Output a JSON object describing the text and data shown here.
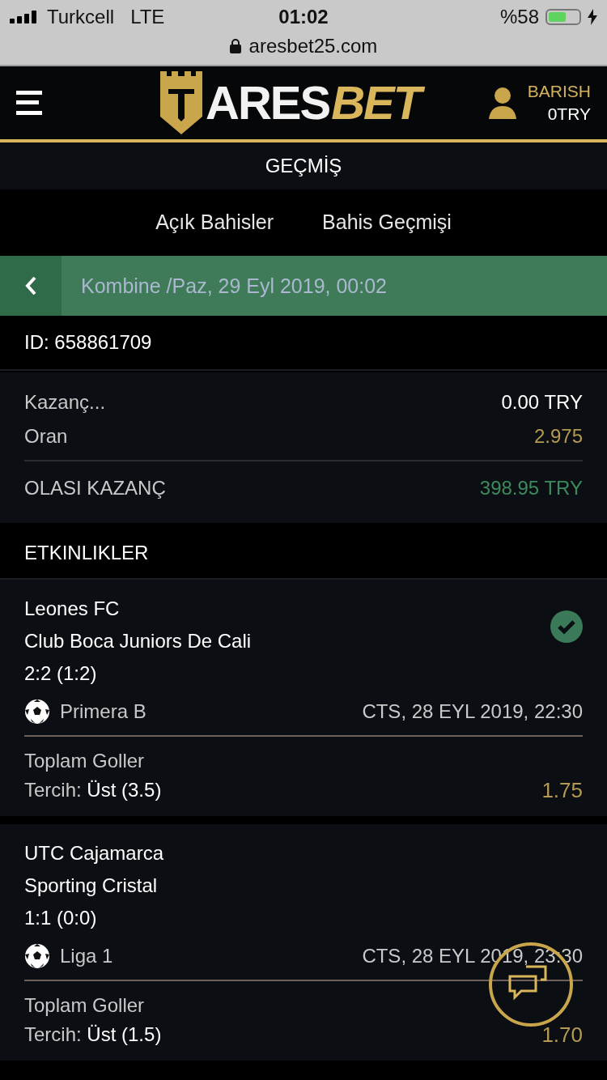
{
  "status_bar": {
    "carrier": "Turkcell",
    "network": "LTE",
    "time": "01:02",
    "battery_percent": "%58",
    "url": "aresbet25.com"
  },
  "header": {
    "logo_left": "ARES",
    "logo_right": "BET",
    "user_name": "BARISH",
    "balance": "0TRY"
  },
  "page_title": "GEÇMİŞ",
  "tabs": [
    {
      "label": "Açık Bahisler",
      "selected": false
    },
    {
      "label": "Bahis Geçmişi",
      "selected": false
    }
  ],
  "bet_header": {
    "title": "Kombine /Paz, 29 Eyl 2019, 00:02"
  },
  "bet_id": "ID: 658861709",
  "summary": [
    {
      "label": "Kazanç...",
      "value": "0.00 TRY",
      "kind": "plain"
    },
    {
      "label": "Oran",
      "value": "2.975",
      "kind": "odds"
    },
    {
      "label": "OLASI KAZANÇ",
      "value": "398.95 TRY",
      "kind": "potential"
    }
  ],
  "events_title": "ETKINLIKLER",
  "events": [
    {
      "team_1": "Leones FC",
      "team_2": "Club Boca Juniors De Cali",
      "score": "2:2 (1:2)",
      "league": "Primera B",
      "date": "CTS, 28 EYL 2019, 22:30",
      "market": "Toplam Goller",
      "pick_label": "Tercih:",
      "pick": "Üst (3.5)",
      "odds": "1.75",
      "won": true
    },
    {
      "team_1": "UTC Cajamarca",
      "team_2": "Sporting Cristal",
      "score": "1:1 (0:0)",
      "league": "Liga 1",
      "date": "CTS, 28 EYL 2019, 23:30",
      "market": "Toplam Goller",
      "pick_label": "Tercih:",
      "pick": "Üst (1.5)",
      "odds": "1.70",
      "won": false
    }
  ]
}
